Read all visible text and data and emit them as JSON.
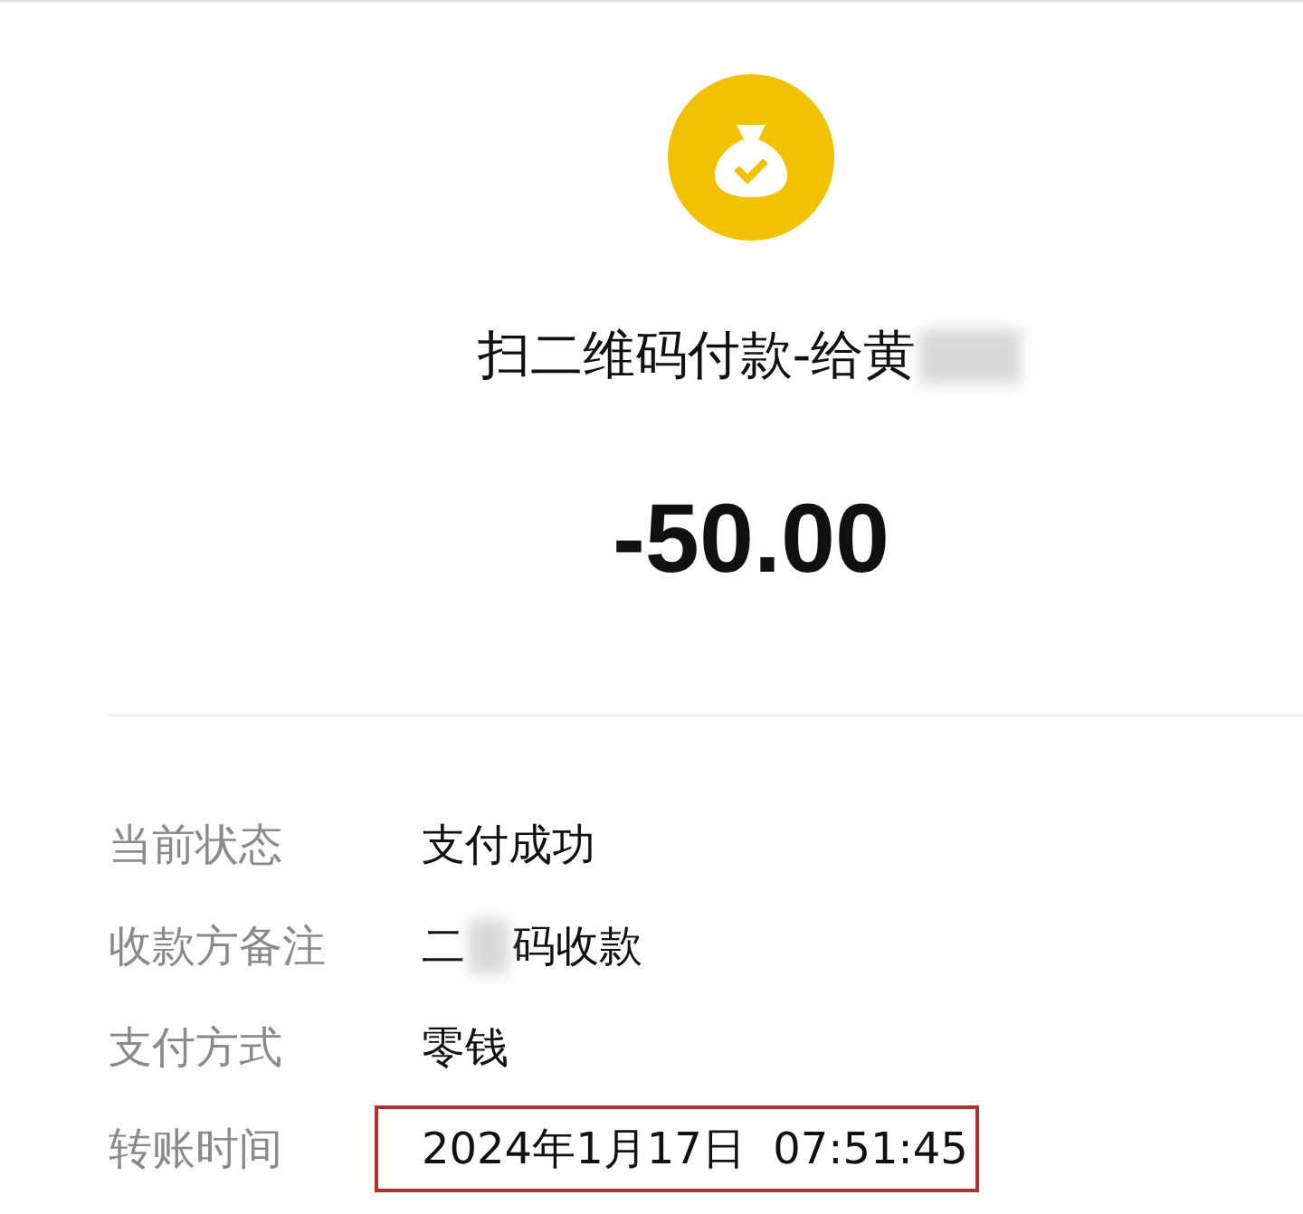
{
  "header": {
    "title": "扫二维码付款-给黄",
    "title_redacted": true,
    "amount": "-50.00"
  },
  "details": [
    {
      "label": "当前状态",
      "value_parts": [
        "支付成功"
      ],
      "highlighted": false
    },
    {
      "label": "收款方备注",
      "value_parts": [
        "二",
        "码收款"
      ],
      "highlighted": false
    },
    {
      "label": "支付方式",
      "value_parts": [
        "零钱"
      ],
      "highlighted": false
    },
    {
      "label": "转账时间",
      "value_parts": [
        "2024年1月17日  07:51:45"
      ],
      "highlighted": true
    }
  ]
}
